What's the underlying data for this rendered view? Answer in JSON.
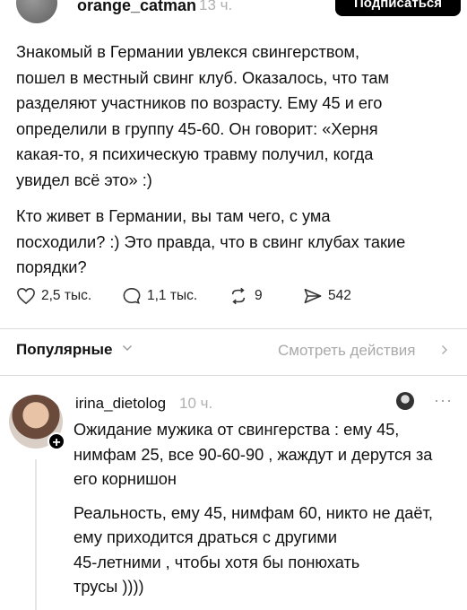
{
  "post": {
    "username": "orange_catman",
    "time": "13 ч.",
    "follow_label": "Подписаться",
    "paragraph1": "Знакомый в Германии увлекся свингерством,\nпошел в местный свинг клуб. Оказалось, что там\nразделяют участников по возрасту. Ему 45 и его\nопределили в группу 45-60. Он говорит: «Херня\nкакая-то, я психическую травму получил, когда\nувидел всё это» :)",
    "paragraph2": "Кто живет в Германии, вы там чего, с ума\nпосходили? :) Это правда, что в свинг клубах такие\nпорядки?",
    "likes": "2,5 тыс.",
    "comments": "1,1 тыс.",
    "reposts": "9",
    "shares": "542"
  },
  "bar": {
    "popular_label": "Популярные",
    "see_actions_label": "Смотреть действия"
  },
  "comment": {
    "username": "irina_dietolog",
    "time": "10 ч.",
    "more": "···",
    "paragraph1": "Ожидание мужика от свингерства : ему 45,\nнимфам 25, все 90-60-90 , жаждут и дерутся за\nего корнишон",
    "paragraph2": "Реальность, ему 45, нимфам 60, никто не даёт,\nему приходится драться с другими\n45-летними , чтобы хотя бы понюхать\nтрусы ))))"
  }
}
